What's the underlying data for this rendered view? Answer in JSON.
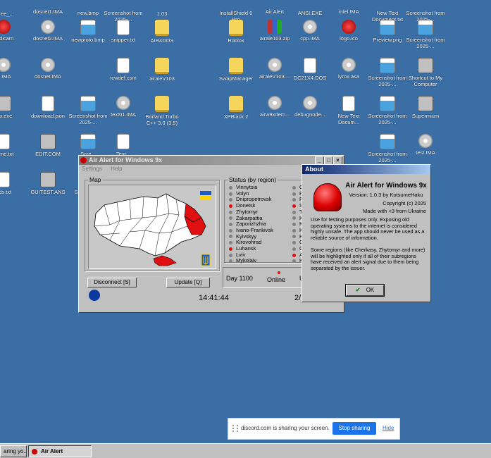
{
  "desktop_icons": [
    {
      "label": "t_free_...",
      "glyph": "folder-icon",
      "kind": "g-folder"
    },
    {
      "label": "dosnet1.IMA",
      "glyph": "disk-icon",
      "kind": "g-cd"
    },
    {
      "label": "new.bmp",
      "glyph": "bitmap-icon",
      "kind": "g-img"
    },
    {
      "label": "Screenshot from 2025-...",
      "glyph": "image-icon",
      "kind": "g-img"
    },
    {
      "label": "1.03",
      "glyph": "folder-icon",
      "kind": "g-folder"
    },
    {
      "label": "InstallShield 6 Pro",
      "glyph": "installer-icon",
      "kind": "g-app"
    },
    {
      "label": "Air Alert",
      "glyph": "siren-icon",
      "kind": "g-red"
    },
    {
      "label": "ANSI.EXE",
      "glyph": "exe-icon",
      "kind": "g-app"
    },
    {
      "label": "intel.IMA",
      "glyph": "disk-icon",
      "kind": "g-cd"
    },
    {
      "label": "New Text Document.txt",
      "glyph": "text-file-icon",
      "kind": "g-file"
    },
    {
      "label": "Screenshot from 2025-...",
      "glyph": "image-icon",
      "kind": "g-img"
    },
    {
      "label": "andicam",
      "glyph": "record-icon",
      "kind": "g-red"
    },
    {
      "label": "dosnet2.IMA",
      "glyph": "disk-icon",
      "kind": "g-cd"
    },
    {
      "label": "newproto.bmp",
      "glyph": "bitmap-icon",
      "kind": "g-img"
    },
    {
      "label": "snipper.txt",
      "glyph": "text-file-icon",
      "kind": "g-file"
    },
    {
      "label": "AIR4DOS",
      "glyph": "folder-icon",
      "kind": "g-folder"
    },
    {
      "label": "Roblox",
      "glyph": "folder-icon",
      "kind": "g-folder"
    },
    {
      "label": "airale103.zip",
      "glyph": "zip-icon",
      "kind": "g-zip"
    },
    {
      "label": "cpp.IMA",
      "glyph": "disk-icon",
      "kind": "g-cd"
    },
    {
      "label": "logo.ico",
      "glyph": "siren-icon",
      "kind": "g-red"
    },
    {
      "label": "Preview.png",
      "glyph": "image-icon",
      "kind": "g-img"
    },
    {
      "label": "Screenshot from 2025-...",
      "glyph": "image-icon",
      "kind": "g-img"
    },
    {
      "label": "bl.IMA",
      "glyph": "disk-icon",
      "kind": "g-cd"
    },
    {
      "label": "dosnet.IMA",
      "glyph": "disk-icon",
      "kind": "g-cd"
    },
    {
      "label": "tcwdef.csm",
      "glyph": "file-icon",
      "kind": "g-file"
    },
    {
      "label": "airaleV103",
      "glyph": "folder-icon",
      "kind": "g-folder"
    },
    {
      "label": "SwapManager",
      "glyph": "folder-icon",
      "kind": "g-folder"
    },
    {
      "label": "airaleV103....",
      "glyph": "disk-icon",
      "kind": "g-cd"
    },
    {
      "label": "DC21X4.DOS",
      "glyph": "file-icon",
      "kind": "g-file"
    },
    {
      "label": "lyrox.asa",
      "glyph": "disk-icon",
      "kind": "g-cd"
    },
    {
      "label": "Screenshot from 2025-...",
      "glyph": "image-icon",
      "kind": "g-img"
    },
    {
      "label": "Shortcut to My Computer",
      "glyph": "computer-icon",
      "kind": "g-app"
    },
    {
      "label": "tup.exe",
      "glyph": "installer-icon",
      "kind": "g-app"
    },
    {
      "label": "download.json",
      "glyph": "file-icon",
      "kind": "g-file"
    },
    {
      "label": "Screenshot from 2025-...",
      "glyph": "image-icon",
      "kind": "g-img"
    },
    {
      "label": "text01.IMA",
      "glyph": "disk-icon",
      "kind": "g-cd"
    },
    {
      "label": "Borland Turbo C++ 3.0 (3.5)",
      "glyph": "folder-icon",
      "kind": "g-folder"
    },
    {
      "label": "XPBlack 2",
      "glyph": "folder-icon",
      "kind": "g-folder"
    },
    {
      "label": "airw9xdem...",
      "glyph": "disk-icon",
      "kind": "g-cd"
    },
    {
      "label": "debugnode...",
      "glyph": "disk-icon",
      "kind": "g-cd"
    },
    {
      "label": "New Text Docum...",
      "glyph": "text-file-icon",
      "kind": "g-file"
    },
    {
      "label": "Screenshot from 2025-...",
      "glyph": "image-icon",
      "kind": "g-img"
    },
    {
      "label": "Supermium",
      "glyph": "browser-icon",
      "kind": "g-app"
    },
    {
      "label": "adme.txt",
      "glyph": "text-file-icon",
      "kind": "g-file"
    },
    {
      "label": "EDIT.COM",
      "glyph": "dos-window-icon",
      "kind": "g-app"
    },
    {
      "label": "Scre...",
      "glyph": "image-icon",
      "kind": "g-img"
    },
    {
      "label": "Text...",
      "glyph": "text-file-icon",
      "kind": "g-file"
    },
    {
      "label": "Screenshot from 2025-...",
      "glyph": "image-icon",
      "kind": "g-img"
    },
    {
      "label": "test.IMA",
      "glyph": "disk-icon",
      "kind": "g-cd"
    },
    {
      "label": "nds.txt",
      "glyph": "text-file-icon",
      "kind": "g-file"
    },
    {
      "label": "GUITEST.ANS",
      "glyph": "ansi-art-icon",
      "kind": "g-app"
    },
    {
      "label": "Scre... from",
      "glyph": "image-icon",
      "kind": "g-img"
    }
  ],
  "main_window": {
    "title": "Air Alert for Windows 9x",
    "menu": [
      "Settings",
      "Help"
    ],
    "map_label": "Map",
    "status_label": "Status (by region)",
    "regions": [
      {
        "name": "Vinnytsia",
        "alert": false
      },
      {
        "name": "Volyn",
        "alert": false
      },
      {
        "name": "Dnipropetrovsk",
        "alert": false
      },
      {
        "name": "Donetsk",
        "alert": true
      },
      {
        "name": "Zhytomyr",
        "alert": false
      },
      {
        "name": "Zakarpattia",
        "alert": false
      },
      {
        "name": "Zaporizhzhia",
        "alert": false
      },
      {
        "name": "Ivano-Frankivsk",
        "alert": false
      },
      {
        "name": "Kyivskyy",
        "alert": false
      },
      {
        "name": "Kirovohrad",
        "alert": false
      },
      {
        "name": "Luhansk",
        "alert": true
      },
      {
        "name": "Lviv",
        "alert": false
      },
      {
        "name": "Mykolaiv",
        "alert": false
      }
    ],
    "regions_col2_initials": [
      "O",
      "P",
      "R",
      "S",
      "T",
      "K",
      "K",
      "K",
      "K",
      "C",
      "C",
      "A",
      "K"
    ],
    "regions_col2_alert": [
      false,
      false,
      false,
      true,
      false,
      false,
      false,
      false,
      false,
      false,
      false,
      true,
      false
    ],
    "disconnect_label": "Disconnect [S]",
    "update_label": "Update [Q]",
    "day_label": "Day 1100",
    "online_label": "Online",
    "up_label": "Up",
    "time": "14:41:44",
    "page_label": "2/"
  },
  "about_dialog": {
    "title": "About",
    "app_name": "Air Alert for Windows 9x",
    "version": "Version: 1.0.3 by KotsumeHaku",
    "copyright": "Copyright (c) 2025",
    "made_with": "Made with <3 from Ukraine",
    "notice1": "Use for testing purposes only. Exposing old operating systems to the internet is considered highly unsafe. The app should never be used as a reliable source of information.",
    "notice2": "Some regions (like Cherkasy, Zhytomyr and more) will be highlighted only if all of their subregions have received an alert signal due to them being separated by the issuer.",
    "ok_label": "OK"
  },
  "share_bar": {
    "message": "discord.com is sharing your screen.",
    "stop_label": "Stop sharing",
    "hide_label": "Hide"
  },
  "taskbar": {
    "task1": "aring yo...",
    "task2": "Air Alert"
  },
  "colors": {
    "desktop": "#3a6ea5",
    "alert_red": "#e01010",
    "flag_blue": "#1e5bc6",
    "flag_yellow": "#ffd500",
    "title_active": "#0a246a",
    "share_blue": "#1a73e8"
  }
}
